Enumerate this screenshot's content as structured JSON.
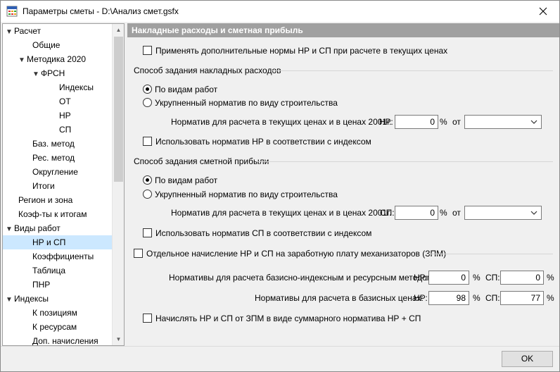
{
  "window": {
    "title": "Параметры сметы - D:\\Анализ смет.gsfx"
  },
  "tree": {
    "items": [
      {
        "label": "Расчет",
        "level": 0,
        "arrow": "▼"
      },
      {
        "label": "Общие",
        "level": 2
      },
      {
        "label": "Методика 2020",
        "level": 1,
        "arrow": "▼"
      },
      {
        "label": "ФРСН",
        "level": 2,
        "arrow": "▼"
      },
      {
        "label": "Индексы",
        "level": 4
      },
      {
        "label": "ОТ",
        "level": 4
      },
      {
        "label": "НР",
        "level": 4
      },
      {
        "label": "СП",
        "level": 4
      },
      {
        "label": "Баз. метод",
        "level": 2
      },
      {
        "label": "Рес. метод",
        "level": 2
      },
      {
        "label": "Округление",
        "level": 2
      },
      {
        "label": "Итоги",
        "level": 2
      },
      {
        "label": "Регион и зона",
        "level": 0.5
      },
      {
        "label": "Коэф-ты к итогам",
        "level": 0.5
      },
      {
        "label": "Виды работ",
        "level": 0,
        "arrow": "▼"
      },
      {
        "label": "НР и СП",
        "level": 2,
        "selected": true
      },
      {
        "label": "Коэффициенты",
        "level": 2
      },
      {
        "label": "Таблица",
        "level": 2
      },
      {
        "label": "ПНР",
        "level": 2
      },
      {
        "label": "Индексы",
        "level": 0,
        "arrow": "▼"
      },
      {
        "label": "К позициям",
        "level": 2
      },
      {
        "label": "К ресурсам",
        "level": 2
      },
      {
        "label": "Доп. начисления",
        "level": 2
      }
    ]
  },
  "panel": {
    "header": "Накладные расходы и сметная прибыль",
    "apply_extra_norms": "Применять дополнительные нормы НР и СП при расчете в текущих ценах",
    "overhead_group": "Способ задания накладных расходов",
    "overhead_by_work": "По видам работ",
    "overhead_enlarged": "Укрупненный норматив по виду строительства",
    "overhead_norm_label": "Норматив для расчета в текущих ценах и в ценах 2001г.",
    "overhead_nr_label": "НР:",
    "overhead_nr_value": "0",
    "percent": "%",
    "from_label": "от",
    "overhead_use_index": "Использовать норматив НР в соответствии с индексом",
    "profit_group": "Способ задания сметной прибыли",
    "profit_by_work": "По видам работ",
    "profit_enlarged": "Укрупненный норматив по виду строительства",
    "profit_norm_label": "Норматив для расчета в текущих ценах и в ценах 2001г.",
    "profit_sp_label": "СП:",
    "profit_sp_value": "0",
    "profit_use_index": "Использовать норматив СП в соответствии с индексом",
    "separate_zpm": "Отдельное начисление НР и СП на заработную плату механизаторов (ЗПМ)",
    "base_index_label": "Нормативы для расчета базисно-индексным и ресурсным методом:",
    "base_prices_label": "Нормативы для расчета в базисных ценах:",
    "nr_label": "НР:",
    "sp_label": "СП:",
    "bi_nr_value": "0",
    "bi_sp_value": "0",
    "bp_nr_value": "98",
    "bp_sp_value": "77",
    "calc_from_zpm": "Начислять НР и СП от ЗПМ в виде суммарного норматива НР + СП"
  },
  "footer": {
    "ok_label": "OK"
  }
}
